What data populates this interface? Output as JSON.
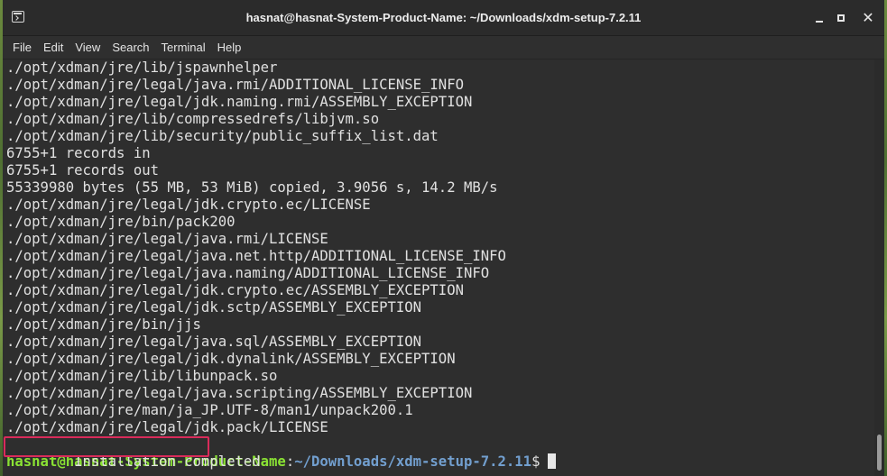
{
  "window": {
    "title": "hasnat@hasnat-System-Product-Name: ~/Downloads/xdm-setup-7.2.11",
    "app_icon": "terminal-icon",
    "buttons": {
      "minimize": "minimize-icon",
      "maximize": "maximize-icon",
      "close": "✕"
    }
  },
  "menubar": {
    "items": [
      "File",
      "Edit",
      "View",
      "Search",
      "Terminal",
      "Help"
    ]
  },
  "terminal": {
    "lines": [
      "./opt/xdman/jre/lib/jspawnhelper",
      "./opt/xdman/jre/legal/java.rmi/ADDITIONAL_LICENSE_INFO",
      "./opt/xdman/jre/legal/jdk.naming.rmi/ASSEMBLY_EXCEPTION",
      "./opt/xdman/jre/lib/compressedrefs/libjvm.so",
      "./opt/xdman/jre/lib/security/public_suffix_list.dat",
      "6755+1 records in",
      "6755+1 records out",
      "55339980 bytes (55 MB, 53 MiB) copied, 3.9056 s, 14.2 MB/s",
      "./opt/xdman/jre/legal/jdk.crypto.ec/LICENSE",
      "./opt/xdman/jre/bin/pack200",
      "./opt/xdman/jre/legal/java.rmi/LICENSE",
      "./opt/xdman/jre/legal/java.net.http/ADDITIONAL_LICENSE_INFO",
      "./opt/xdman/jre/legal/java.naming/ADDITIONAL_LICENSE_INFO",
      "./opt/xdman/jre/legal/jdk.crypto.ec/ASSEMBLY_EXCEPTION",
      "./opt/xdman/jre/legal/jdk.sctp/ASSEMBLY_EXCEPTION",
      "./opt/xdman/jre/bin/jjs",
      "./opt/xdman/jre/legal/java.sql/ASSEMBLY_EXCEPTION",
      "./opt/xdman/jre/legal/jdk.dynalink/ASSEMBLY_EXCEPTION",
      "./opt/xdman/jre/lib/libunpack.so",
      "./opt/xdman/jre/legal/java.scripting/ASSEMBLY_EXCEPTION",
      "./opt/xdman/jre/man/ja_JP.UTF-8/man1/unpack200.1",
      "./opt/xdman/jre/legal/jdk.pack/LICENSE"
    ],
    "completion_message": "Installation completed",
    "prompt": {
      "user_host": "hasnat@hasnat-System-Product-Name",
      "separator": ":",
      "path": "~/Downloads/xdm-setup-7.2.11",
      "symbol": "$"
    }
  },
  "colors": {
    "prompt_user": "#8ae234",
    "prompt_path": "#729fcf",
    "highlight_box": "#d92b5a",
    "terminal_bg": "#2e2e2e"
  }
}
